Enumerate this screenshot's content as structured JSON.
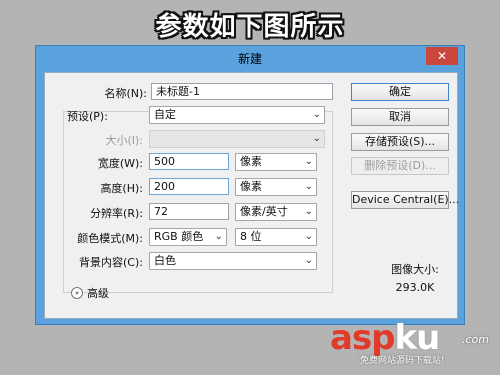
{
  "banner": "参数如下图所示",
  "dialog": {
    "title": "新建",
    "close_glyph": "✕"
  },
  "form": {
    "name_label": "名称(N):",
    "name_value": "未标题-1",
    "preset_label": "预设(P):",
    "preset_value": "自定",
    "size_label": "大小(I):",
    "size_value": "",
    "width_label": "宽度(W):",
    "width_value": "500",
    "width_unit": "像素",
    "height_label": "高度(H):",
    "height_value": "200",
    "height_unit": "像素",
    "resolution_label": "分辨率(R):",
    "resolution_value": "72",
    "resolution_unit": "像素/英寸",
    "color_mode_label": "颜色模式(M):",
    "color_mode_value": "RGB 颜色",
    "bit_depth_value": "8 位",
    "background_label": "背景内容(C):",
    "background_value": "白色",
    "advanced_label": "高级",
    "dropdown_glyph": "⌄",
    "advanced_glyph": "»"
  },
  "buttons": {
    "ok": "确定",
    "cancel": "取消",
    "save_preset": "存储预设(S)...",
    "delete_preset": "删除预设(D)...",
    "device_central": "Device Central(E)..."
  },
  "image_size": {
    "label": "图像大小:",
    "value": "293.0K"
  },
  "watermark": {
    "asp": "asp",
    "ku": "ku",
    "com": ".com",
    "subtitle": "免费网站源码下载站!"
  },
  "colors": {
    "titlebar": "#5aa2dd",
    "close_button": "#c9473d",
    "watermark_red": "#e23a2a"
  }
}
